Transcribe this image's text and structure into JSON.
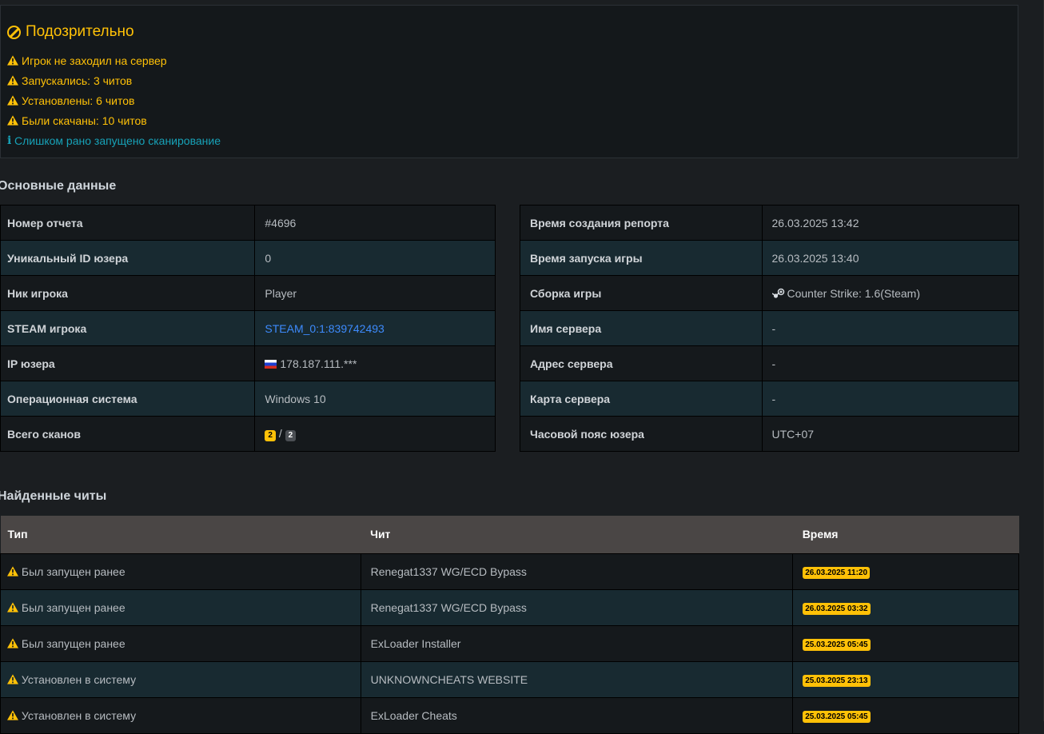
{
  "alert": {
    "title": "Подозрительно",
    "lines": [
      {
        "text": "Игрок не заходил на сервер",
        "level": "warning"
      },
      {
        "text": "Запускались: 3 читов",
        "level": "warning"
      },
      {
        "text": "Установлены: 6 читов",
        "level": "warning"
      },
      {
        "text": "Были скачаны: 10 читов",
        "level": "warning"
      },
      {
        "text": "Слишком рано запущено сканирование",
        "level": "info"
      }
    ]
  },
  "main_data": {
    "title": "Основные данные",
    "left": [
      {
        "key": "Номер отчета",
        "value": "#4696"
      },
      {
        "key": "Уникальный ID юзера",
        "value": "0"
      },
      {
        "key": "Ник игрока",
        "value": "Player"
      },
      {
        "key": "STEAM игрока",
        "value": "STEAM_0:1:839742493"
      },
      {
        "key": "IP юзера",
        "value": "178.187.111.***"
      },
      {
        "key": "Операционная система",
        "value": "Windows 10"
      },
      {
        "key": "Всего сканов",
        "value_a": "2",
        "separator": "/",
        "value_b": "2"
      }
    ],
    "right": [
      {
        "key": "Время создания репорта",
        "value": "26.03.2025 13:42"
      },
      {
        "key": "Время запуска игры",
        "value": "26.03.2025 13:40"
      },
      {
        "key": "Сборка игры",
        "value": "Counter Strike: 1.6(Steam)"
      },
      {
        "key": "Имя сервера",
        "value": "-"
      },
      {
        "key": "Адрес сервера",
        "value": "-"
      },
      {
        "key": "Карта сервера",
        "value": "-"
      },
      {
        "key": "Часовой пояс юзера",
        "value": "UTC+07"
      }
    ]
  },
  "cheats": {
    "title": "Найденные читы",
    "headers": {
      "type": "Тип",
      "cheat": "Чит",
      "time": "Время"
    },
    "rows": [
      {
        "type": "Был запущен ранее",
        "cheat": "Renegat1337 WG/ECD Bypass",
        "time": "26.03.2025 11:20"
      },
      {
        "type": "Был запущен ранее",
        "cheat": "Renegat1337 WG/ECD Bypass",
        "time": "26.03.2025 03:32"
      },
      {
        "type": "Был запущен ранее",
        "cheat": "ExLoader Installer",
        "time": "25.03.2025 05:45"
      },
      {
        "type": "Установлен в систему",
        "cheat": "UNKNOWNCHEATS WEBSITE",
        "time": "25.03.2025 23:13"
      },
      {
        "type": "Установлен в систему",
        "cheat": "ExLoader Cheats",
        "time": "25.03.2025 05:45"
      }
    ]
  },
  "colors": {
    "warning": "#ffc107",
    "info": "#17a2b8",
    "link": "#3d8bfd"
  }
}
